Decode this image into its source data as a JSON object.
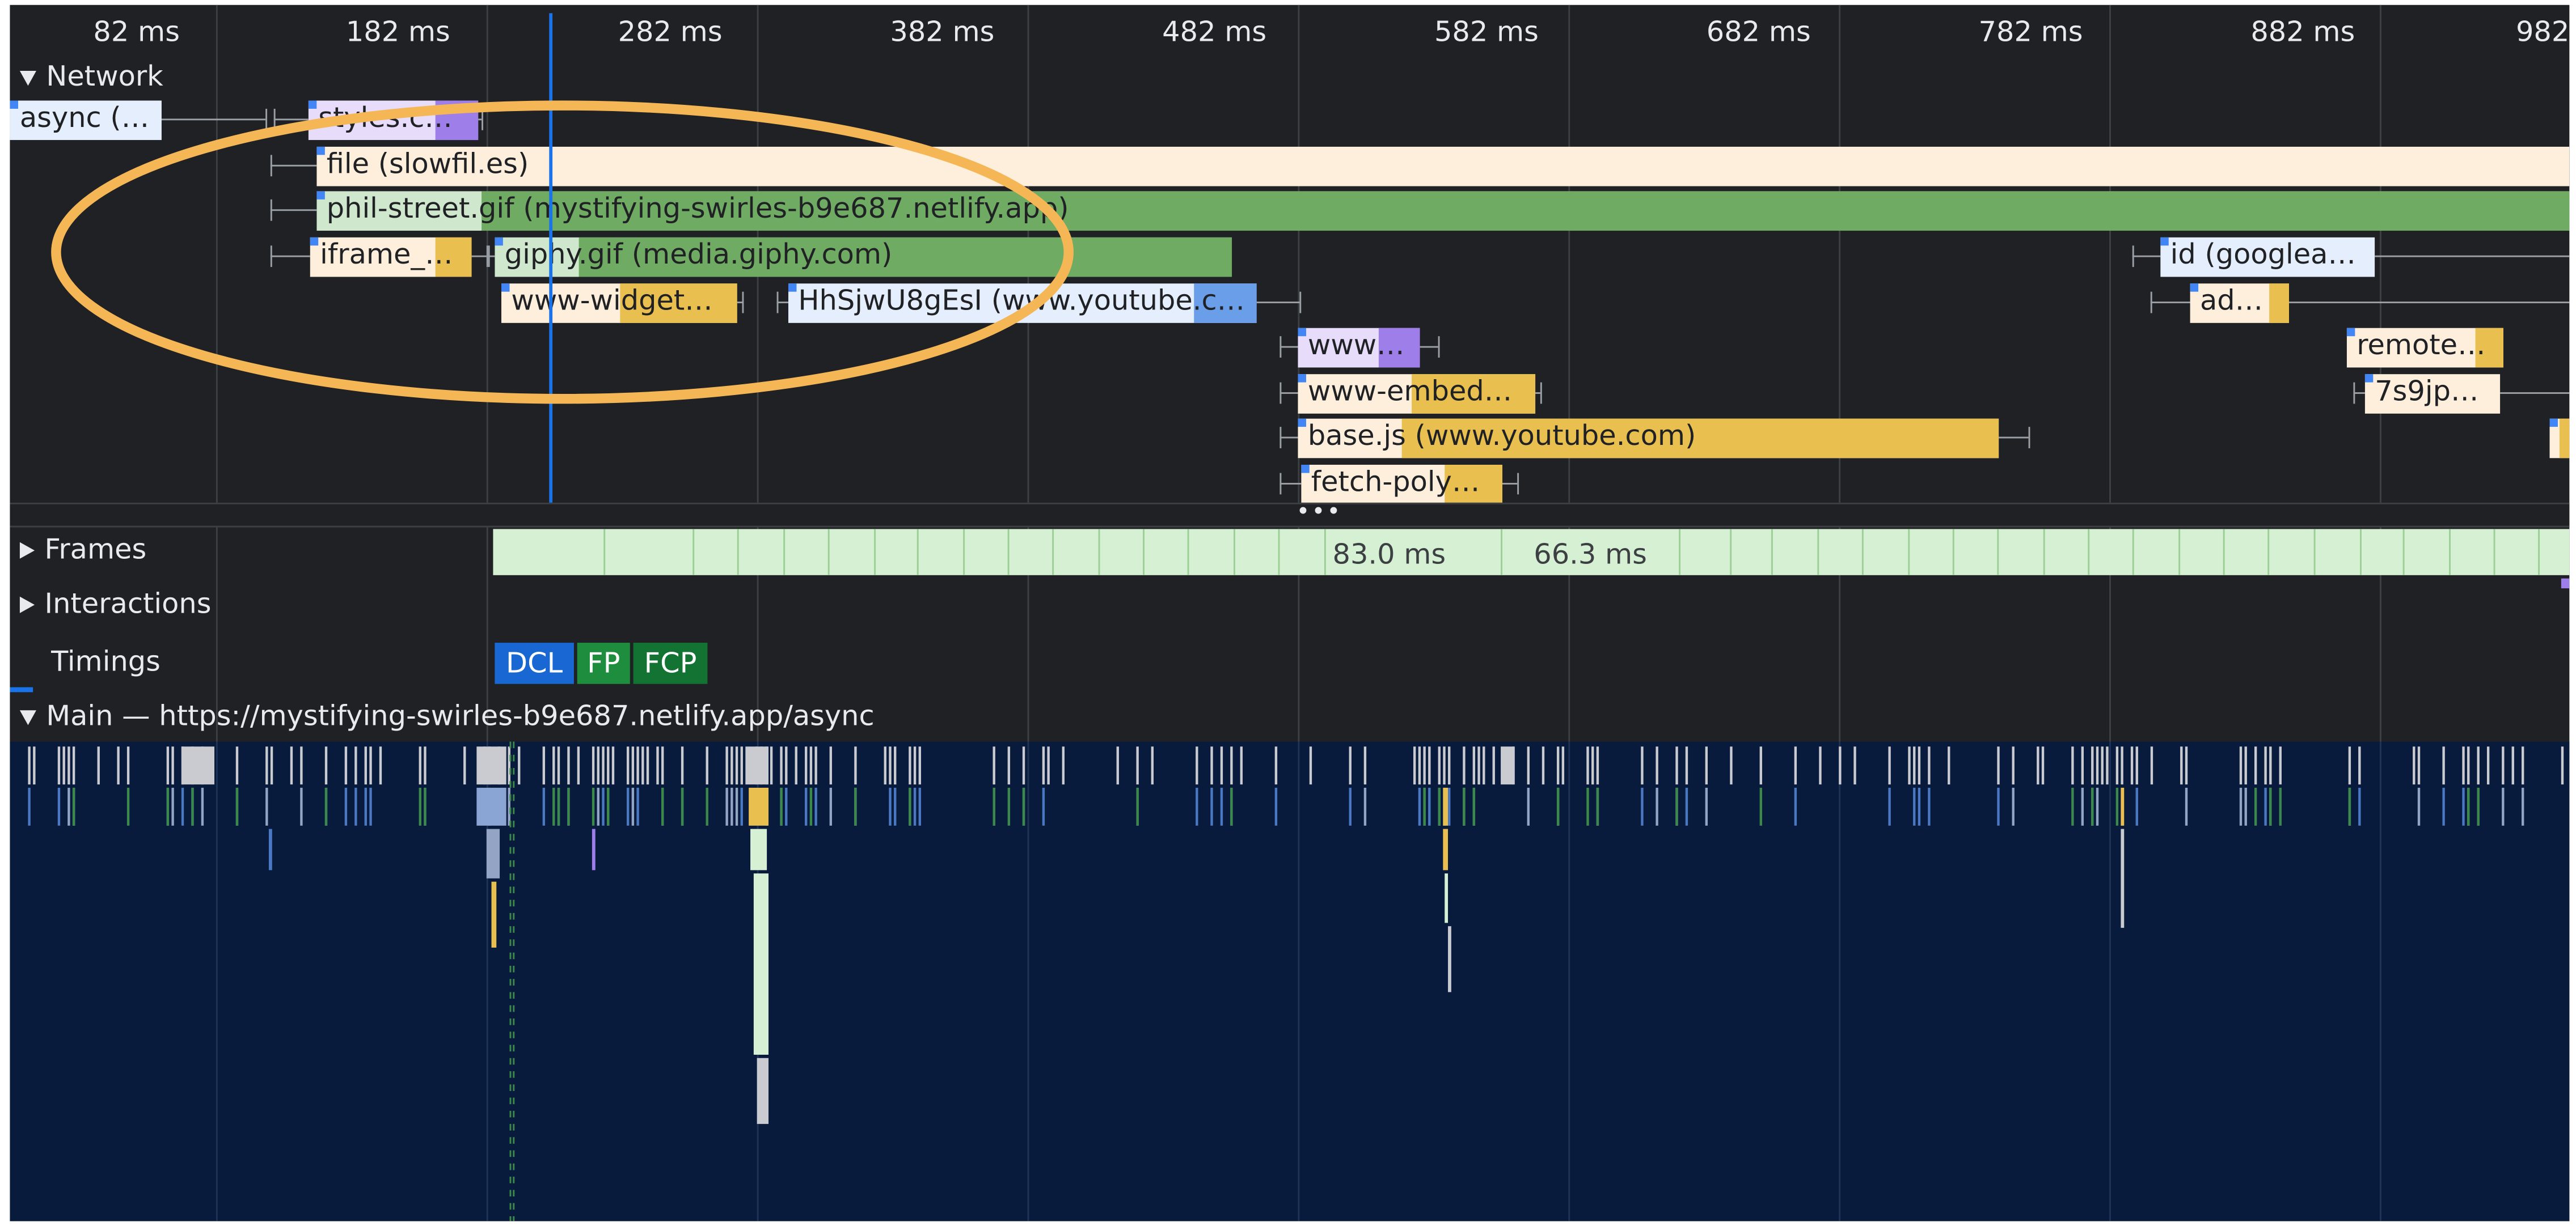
{
  "ruler": {
    "ticks": [
      "82 ms",
      "182 ms",
      "282 ms",
      "382 ms",
      "482 ms",
      "582 ms",
      "682 ms",
      "782 ms",
      "882 ms",
      "982"
    ]
  },
  "tracks": {
    "network": "Network",
    "frames": "Frames",
    "interactions": "Interactions",
    "timings": "Timings",
    "main": "Main — https://mystifying-swirles-b9e687.netlify.app/async"
  },
  "network_requests": [
    {
      "label": "async (…",
      "color": "#e4eefc",
      "dark": "#9dbbee"
    },
    {
      "label": "styles.c…",
      "color": "#e7ddfb",
      "dark": "#9e7ee8"
    },
    {
      "label": "file (slowfil.es)",
      "color": "#fdefdc",
      "dark": "#fdefdc"
    },
    {
      "label": "phil-street.gif (mystifying-swirles-b9e687.netlify.app)",
      "color": "#cfe7cc",
      "dark": "#6fab62"
    },
    {
      "label": "iframe_…",
      "color": "#fdefdc",
      "dark": "#e9c04f"
    },
    {
      "label": "giphy.gif (media.giphy.com)",
      "color": "#cfe7cc",
      "dark": "#6fab62"
    },
    {
      "label": "www-widget…",
      "color": "#fdefdc",
      "dark": "#e9c04f"
    },
    {
      "label": "HhSjwU8gEsI (www.youtube.c…",
      "color": "#e4eefc",
      "dark": "#6b9ee8"
    },
    {
      "label": "www…",
      "color": "#e7ddfb",
      "dark": "#9e7ee8"
    },
    {
      "label": "www-embed…",
      "color": "#fdefdc",
      "dark": "#e9c04f"
    },
    {
      "label": "base.js (www.youtube.com)",
      "color": "#fdefdc",
      "dark": "#e9c04f"
    },
    {
      "label": "fetch-poly…",
      "color": "#fdefdc",
      "dark": "#e9c04f"
    },
    {
      "label": "id (googlea…",
      "color": "#e4eefc",
      "dark": "#e4eefc"
    },
    {
      "label": "ad…",
      "color": "#fdefdc",
      "dark": "#e9c04f"
    },
    {
      "label": "remote…",
      "color": "#fdefdc",
      "dark": "#e9c04f"
    },
    {
      "label": "7s9jp…",
      "color": "#fdefdc",
      "dark": "#fdefdc"
    },
    {
      "label": "",
      "color": "#fdefdc",
      "dark": "#e9c04f"
    }
  ],
  "frames": {
    "labels": [
      "83.0 ms",
      "66.3 ms"
    ]
  },
  "timings": [
    {
      "label": "DCL",
      "color": "#1967d2"
    },
    {
      "label": "FP",
      "color": "#1e8e3e"
    },
    {
      "label": "FCP",
      "color": "#137333"
    }
  ],
  "annotation": {
    "color": "#f5b756"
  }
}
